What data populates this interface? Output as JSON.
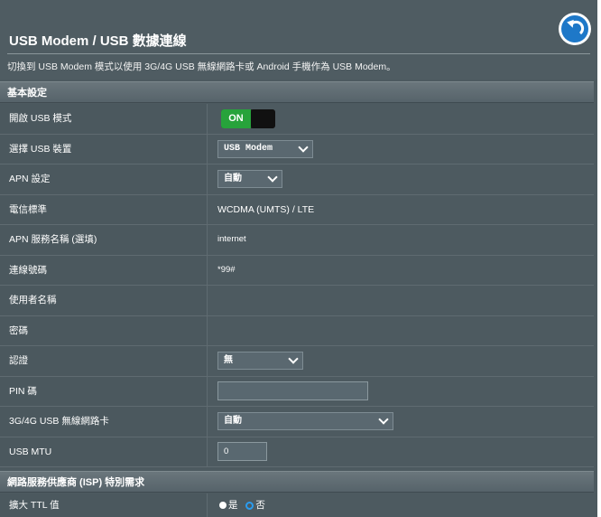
{
  "page": {
    "title": "USB Modem / USB 數據連線",
    "description": "切換到 USB Modem 模式以使用 3G/4G USB 無線網路卡或 Android 手機作為 USB Modem。"
  },
  "sections": {
    "basic": "基本設定",
    "isp": "網路服務供應商 (ISP) 特別需求"
  },
  "fields": {
    "enable_usb": {
      "label": "開啟 USB 模式",
      "value": "ON"
    },
    "usb_device": {
      "label": "選擇 USB 裝置",
      "value": "USB Modem"
    },
    "apn_config": {
      "label": "APN 設定",
      "value": "自動"
    },
    "telecom_std": {
      "label": "電信標準",
      "value": "WCDMA (UMTS) / LTE"
    },
    "apn_name": {
      "label": "APN 服務名稱 (選填)",
      "value": "internet"
    },
    "dial_number": {
      "label": "連線號碼",
      "value": "*99#"
    },
    "username": {
      "label": "使用者名稱",
      "value": ""
    },
    "password": {
      "label": "密碼",
      "value": ""
    },
    "auth": {
      "label": "認證",
      "value": "無"
    },
    "pin": {
      "label": "PIN 碼",
      "value": ""
    },
    "adapter": {
      "label": "3G/4G USB 無線網路卡",
      "value": "自動"
    },
    "usb_mtu": {
      "label": "USB MTU",
      "value": "0"
    },
    "extend_ttl": {
      "label": "擴大 TTL 值",
      "yes": "是",
      "no": "否",
      "selected": "no"
    }
  },
  "colors": {
    "panel_bg": "#4d5a60",
    "toggle_on": "#27a33b",
    "back_button": "#1e78c8"
  },
  "icons": {
    "back": "back-arrow-icon"
  }
}
